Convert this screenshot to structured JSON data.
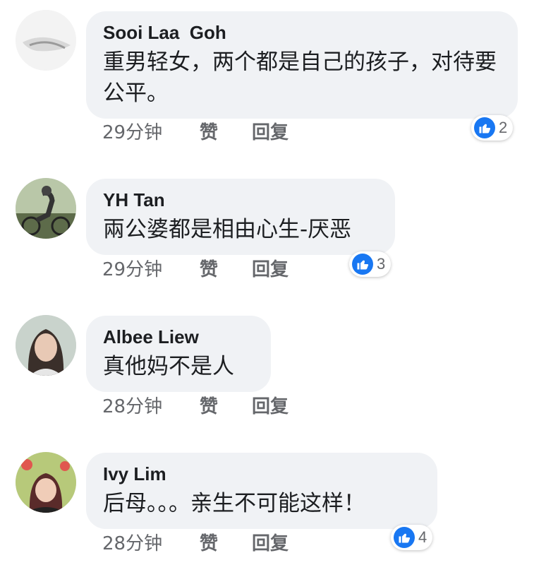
{
  "comments": [
    {
      "author": "Sooi Laa  Goh",
      "text": "重男轻女，两个都是自己的孩子，对待要公平。",
      "time": "29分钟",
      "like_label": "赞",
      "reply_label": "回复",
      "reactions": "2"
    },
    {
      "author": "YH Tan",
      "text": "兩公婆都是相由心生-厌恶",
      "time": "29分钟",
      "like_label": "赞",
      "reply_label": "回复",
      "reactions": "3"
    },
    {
      "author": "Albee Liew",
      "text": "真他妈不是人",
      "time": "28分钟",
      "like_label": "赞",
      "reply_label": "回复"
    },
    {
      "author": "Ivy Lim",
      "text": "后母。。。亲生不可能这样！",
      "time": "28分钟",
      "like_label": "赞",
      "reply_label": "回复",
      "reactions": "4"
    }
  ],
  "colors": {
    "bubble": "#f0f2f5",
    "like_blue": "#1877f2",
    "meta_gray": "#65676b"
  },
  "icons": {
    "reaction": "thumbs-up-icon"
  }
}
